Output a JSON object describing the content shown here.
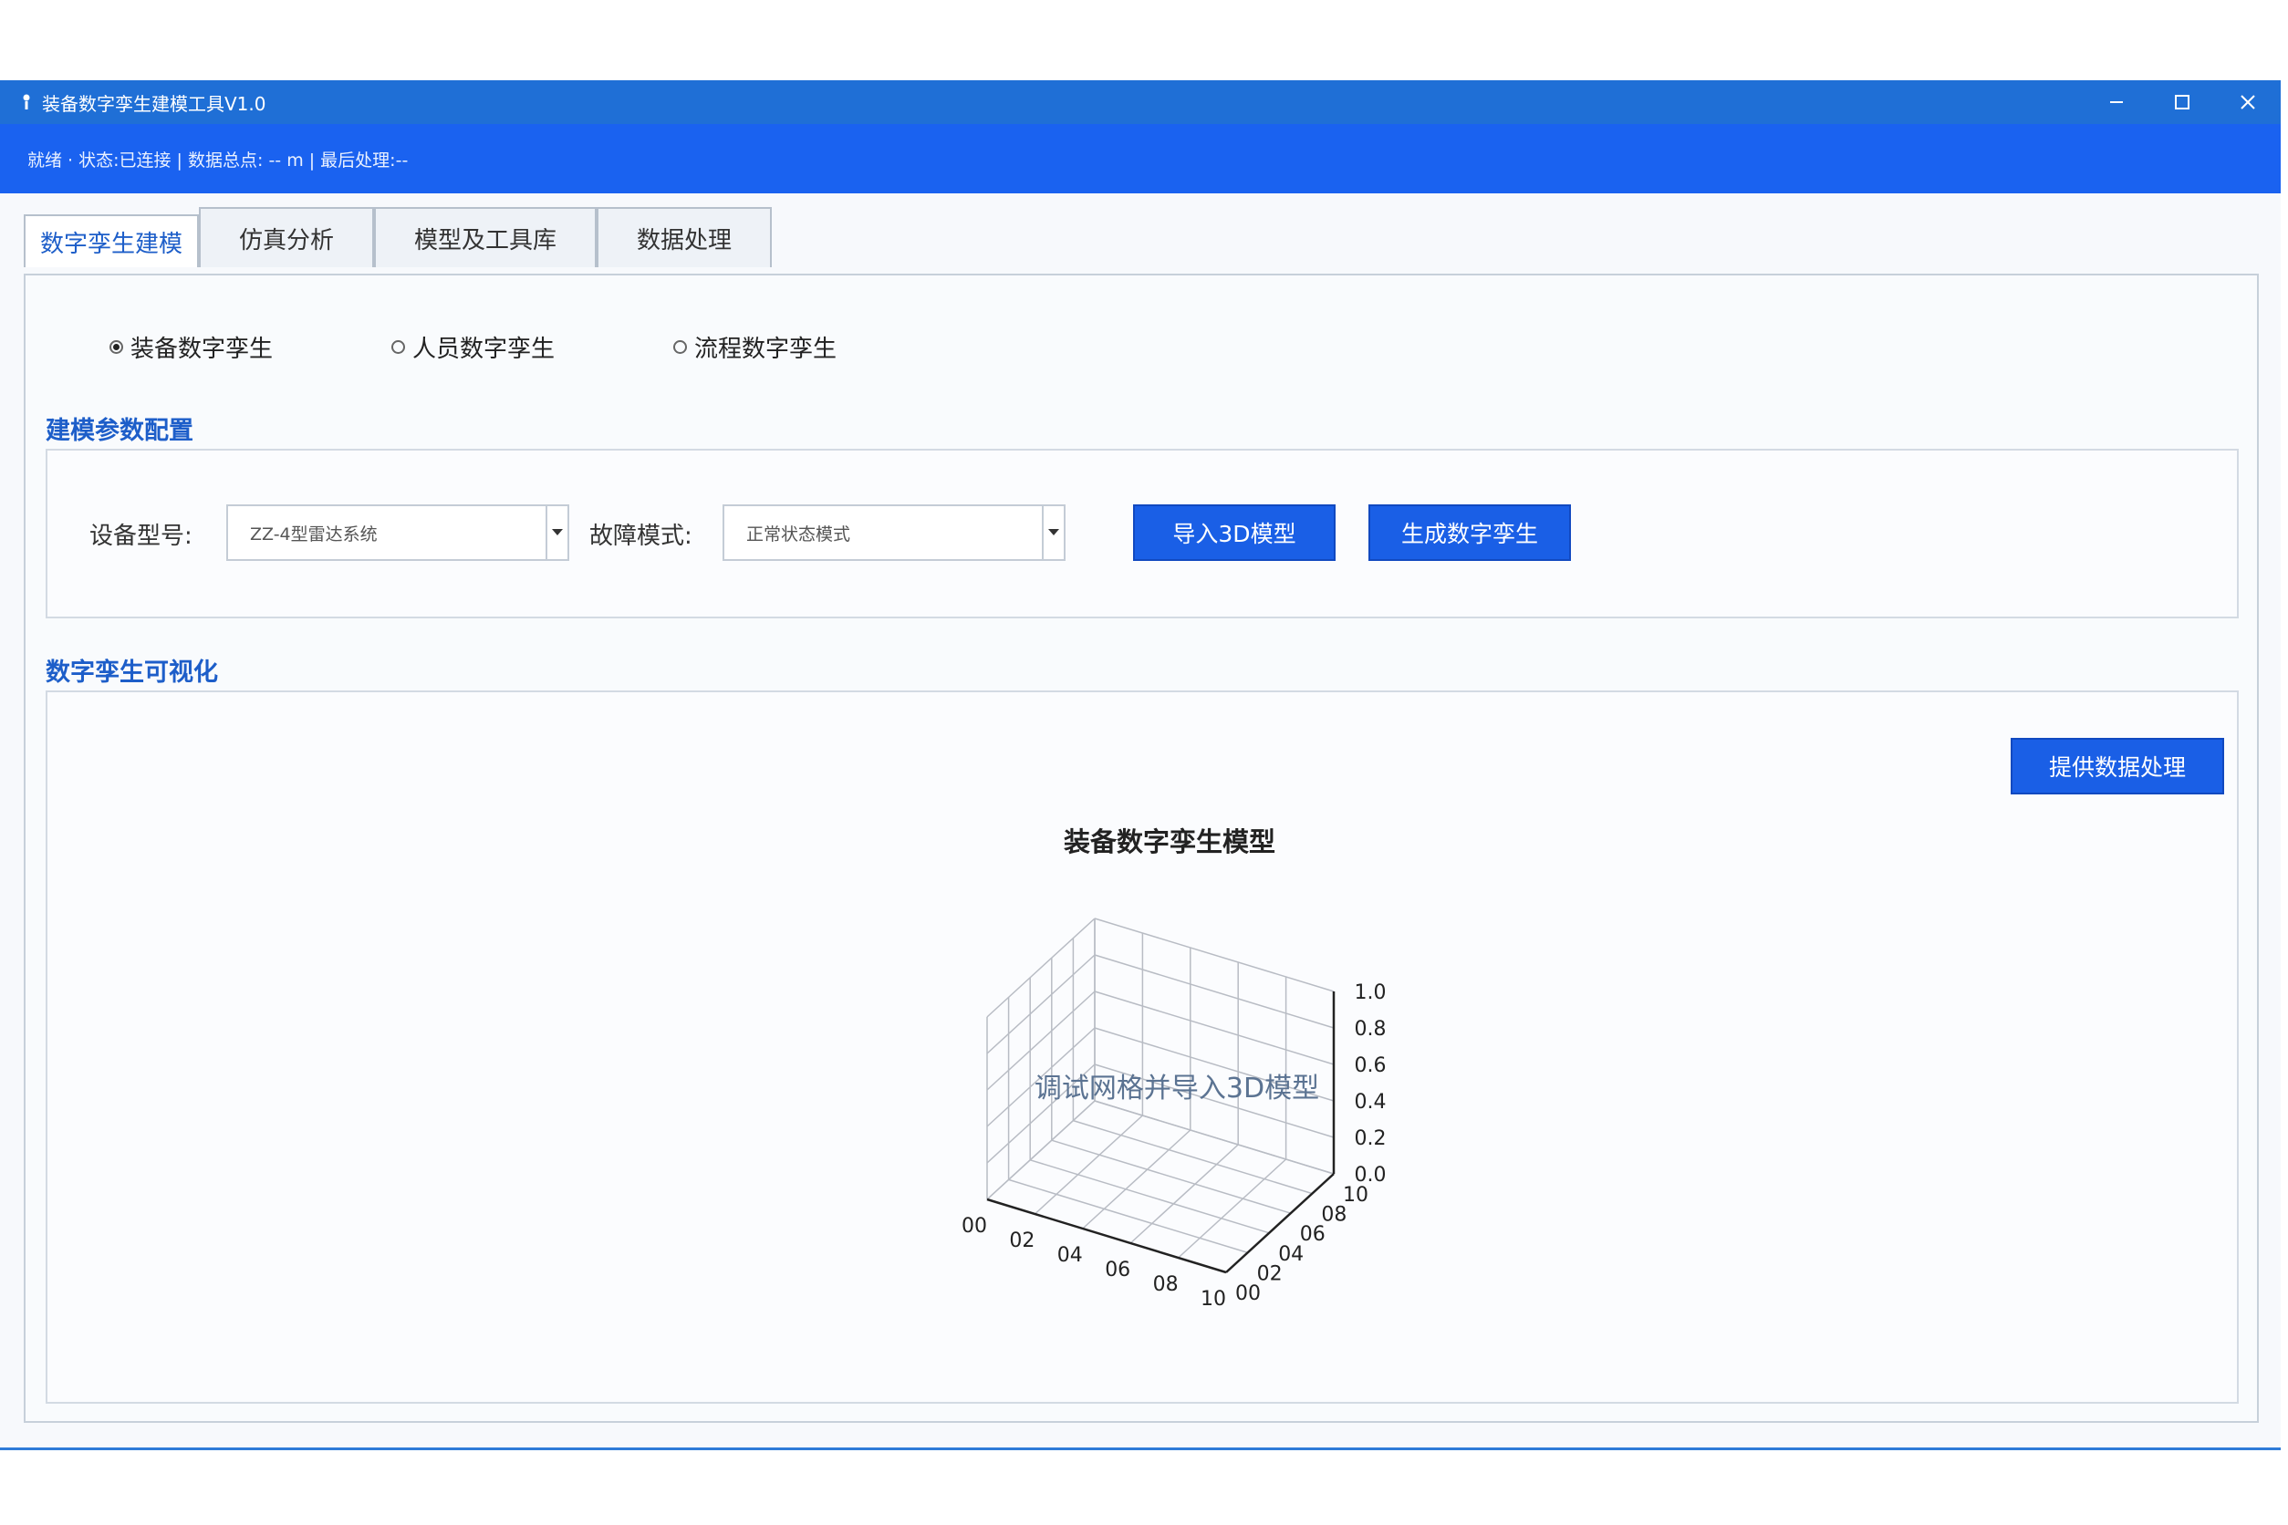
{
  "window": {
    "title": "装备数字孪生建模工具V1.0"
  },
  "statusbar": {
    "text": "就绪 · 状态:已连接 | 数据总点: -- m | 最后处理:--"
  },
  "tabs": [
    {
      "label": "数字孪生建模",
      "active": true
    },
    {
      "label": "仿真分析",
      "active": false
    },
    {
      "label": "模型及工具库",
      "active": false
    },
    {
      "label": "数据处理",
      "active": false
    }
  ],
  "twin_types": [
    {
      "label": "装备数字孪生",
      "selected": true
    },
    {
      "label": "人员数字孪生",
      "selected": false
    },
    {
      "label": "流程数字孪生",
      "selected": false
    }
  ],
  "config": {
    "section_title": "建模参数配置",
    "device_label": "设备型号:",
    "device_value": "ZZ-4型雷达系统",
    "fault_label": "故障模式:",
    "fault_value": "正常状态模式",
    "import_button": "导入3D模型",
    "generate_button": "生成数字孪生"
  },
  "visualization": {
    "section_title": "数字孪生可视化",
    "data_button": "提供数据处理",
    "overlay_text": "调试网格并导入3D模型"
  },
  "chart_data": {
    "type": "3d-axes",
    "title": "装备数字孪生模型",
    "x_ticks": [
      "00",
      "02",
      "04",
      "06",
      "08",
      "10"
    ],
    "y_ticks": [
      "00",
      "02",
      "04",
      "06",
      "08",
      "10"
    ],
    "z_ticks": [
      "0.0",
      "0.2",
      "0.4",
      "0.6",
      "0.8",
      "1.0"
    ],
    "xlim": [
      0,
      1
    ],
    "ylim": [
      0,
      1
    ],
    "zlim": [
      0,
      1
    ],
    "grid": true
  }
}
